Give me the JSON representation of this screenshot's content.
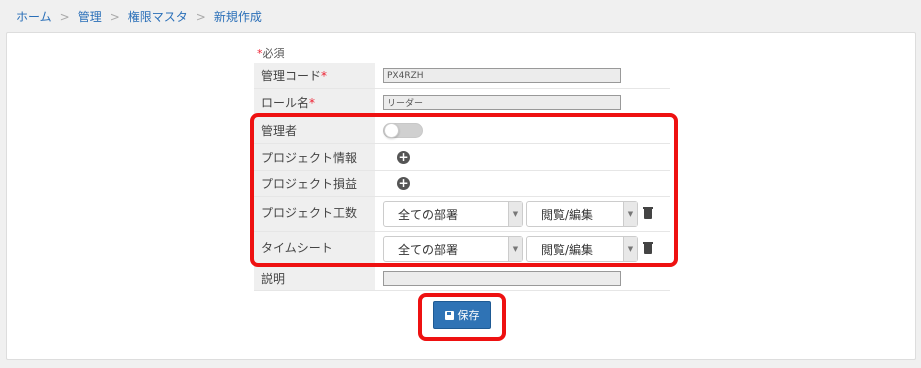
{
  "breadcrumb": {
    "items": [
      "ホーム",
      "管理",
      "権限マスタ",
      "新規作成"
    ],
    "separator": ">"
  },
  "form": {
    "required_note": "必須",
    "required_mark": "*",
    "fields": {
      "code": {
        "label": "管理コード",
        "value": "PX4RZH"
      },
      "role": {
        "label": "ロール名",
        "value": "リーダー"
      },
      "admin": {
        "label": "管理者",
        "toggle_on": false
      },
      "project_info": {
        "label": "プロジェクト情報"
      },
      "project_pl": {
        "label": "プロジェクト損益"
      },
      "project_hours": {
        "label": "プロジェクト工数",
        "dept": "全ての部署",
        "perm": "閲覧/編集"
      },
      "timesheet": {
        "label": "タイムシート",
        "dept": "全ての部署",
        "perm": "閲覧/編集"
      },
      "description": {
        "label": "説明",
        "value": ""
      }
    }
  },
  "icons": {
    "add": "plus-circle-icon",
    "delete": "trash-icon",
    "save": "floppy-disk-icon",
    "dropdown": "chevron-down-icon"
  },
  "save_button": {
    "label": "保存"
  },
  "colors": {
    "link": "#2a6fb8",
    "required": "#ee2233",
    "highlight": "#ee1111",
    "primary_button": "#2f73b5"
  }
}
